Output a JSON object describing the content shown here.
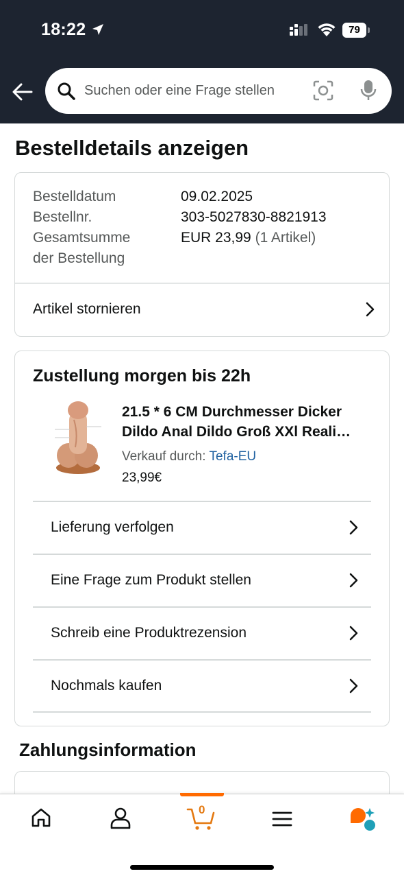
{
  "status_bar": {
    "time": "18:22",
    "battery": "79"
  },
  "search": {
    "placeholder": "Suchen oder eine Frage stellen"
  },
  "page": {
    "title": "Bestelldetails anzeigen"
  },
  "order_summary": {
    "date_label": "Bestelldatum",
    "date_value": "09.02.2025",
    "number_label": "Bestellnr.",
    "number_value": "303-5027830-8821913",
    "total_label_line1": "Gesamtsumme",
    "total_label_line2": "der Bestellung",
    "total_value": "EUR 23,99",
    "total_items": "(1 Artikel)",
    "cancel_label": "Artikel stornieren"
  },
  "delivery": {
    "title": "Zustellung morgen bis 22h",
    "product": {
      "title_line1": "21.5 * 6 CM Durchmesser Dicker",
      "title_line2": "Dildo Anal Dildo Groß XXl Reali…",
      "seller_label": "Verkauf durch:",
      "seller_name": "Tefa-EU",
      "price": "23,99€"
    },
    "actions": [
      {
        "label": "Lieferung verfolgen"
      },
      {
        "label": "Eine Frage zum Produkt stellen"
      },
      {
        "label": "Schreib eine Produktrezension"
      },
      {
        "label": "Nochmals kaufen"
      }
    ]
  },
  "payment": {
    "title": "Zahlungsinformation"
  },
  "bottom_nav": {
    "items": [
      "home-icon",
      "account-icon",
      "cart-icon",
      "menu-icon",
      "assistant-icon"
    ],
    "cart_count": "0",
    "accent_color": "#ff6a00"
  },
  "colors": {
    "header_bg": "#1d2430",
    "link": "#2162a1",
    "muted_text": "#565959"
  }
}
